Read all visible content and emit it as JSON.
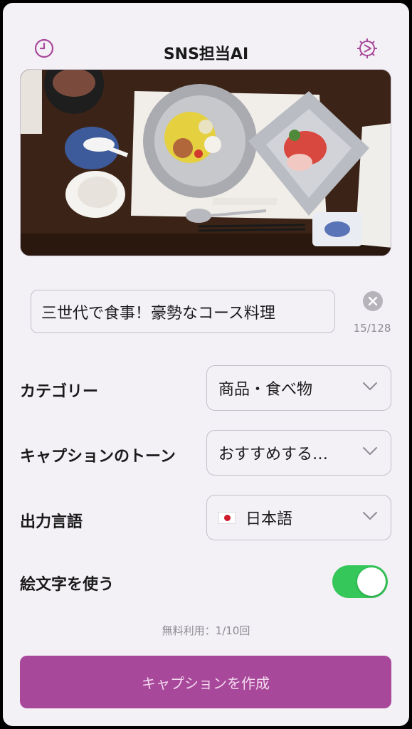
{
  "header": {
    "title": "SNS担当AI",
    "left_icon": "history-clock-icon",
    "right_icon": "settings-gear-icon",
    "accent": "#a8489a"
  },
  "photo": {
    "alt": "食卓の料理写真"
  },
  "title_field": {
    "value": "三世代で食事！豪勢なコース料理",
    "counter": "15/128"
  },
  "settings": {
    "category": {
      "label": "カテゴリー",
      "value": "商品・食べ物"
    },
    "tone": {
      "label": "キャプションのトーン",
      "value": "おすすめする…"
    },
    "language": {
      "label": "出力言語",
      "value": "日本語",
      "flag": "japan-flag"
    },
    "emoji": {
      "label": "絵文字を使う",
      "enabled": true,
      "on_color": "#35c759"
    }
  },
  "usage": "無料利用：1/10回",
  "primary_button": {
    "label": "キャプションを作成",
    "color": "#a8489a"
  }
}
